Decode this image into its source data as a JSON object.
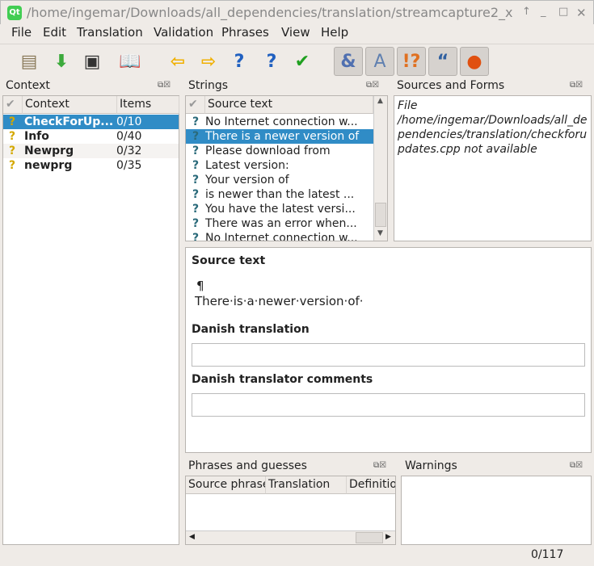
{
  "window": {
    "title": "/home/ingemar/Downloads/all_dependencies/translation/streamcapture2_x",
    "logo": "Qt"
  },
  "menu": [
    "File",
    "Edit",
    "Translation",
    "Validation",
    "Phrases",
    "View",
    "Help"
  ],
  "toolbar": {
    "icons": [
      "open-icon",
      "save-icon",
      "print-icon",
      "phrasebook-icon",
      "prev-icon",
      "next-icon",
      "prev-unfinished-icon",
      "next-unfinished-icon",
      "done-next-icon",
      "accelerator-check-icon",
      "punctuation-check-icon",
      "phrase-check-icon",
      "placemarker-check-icon",
      "surrounding-whitespace-check-icon"
    ]
  },
  "context": {
    "title": "Context",
    "columns": [
      "Context",
      "Items"
    ],
    "rows": [
      {
        "name": "CheckForUp...",
        "items": "0/10"
      },
      {
        "name": "Info",
        "items": "0/40"
      },
      {
        "name": "Newprg",
        "items": "0/32"
      },
      {
        "name": "newprg",
        "items": "0/35"
      }
    ]
  },
  "strings": {
    "title": "Strings",
    "column": "Source text",
    "rows": [
      "No Internet connection w...",
      "There is a newer version of",
      "Please download from",
      "Latest version:",
      "Your version of",
      "is newer than the latest ...",
      "You have the latest versi...",
      "There was an error when...",
      "No Internet connection w..."
    ]
  },
  "sources": {
    "title": "Sources and Forms",
    "message": "File /home/ingemar/Downloads/all_dependencies/translation/checkforupdates.cpp not available"
  },
  "editor": {
    "source_label": "Source text",
    "source_line1": "¶",
    "source_line2": "There·is·a·newer·version·of·",
    "translation_label": "Danish translation",
    "translation_value": "",
    "comments_label": "Danish translator comments",
    "comments_value": ""
  },
  "phrases": {
    "title": "Phrases and guesses",
    "columns": [
      "Source phrase",
      "Translation",
      "Definition"
    ]
  },
  "warnings": {
    "title": "Warnings"
  },
  "status": {
    "count": "0/117"
  },
  "colors": {
    "selection": "#308cc6"
  }
}
